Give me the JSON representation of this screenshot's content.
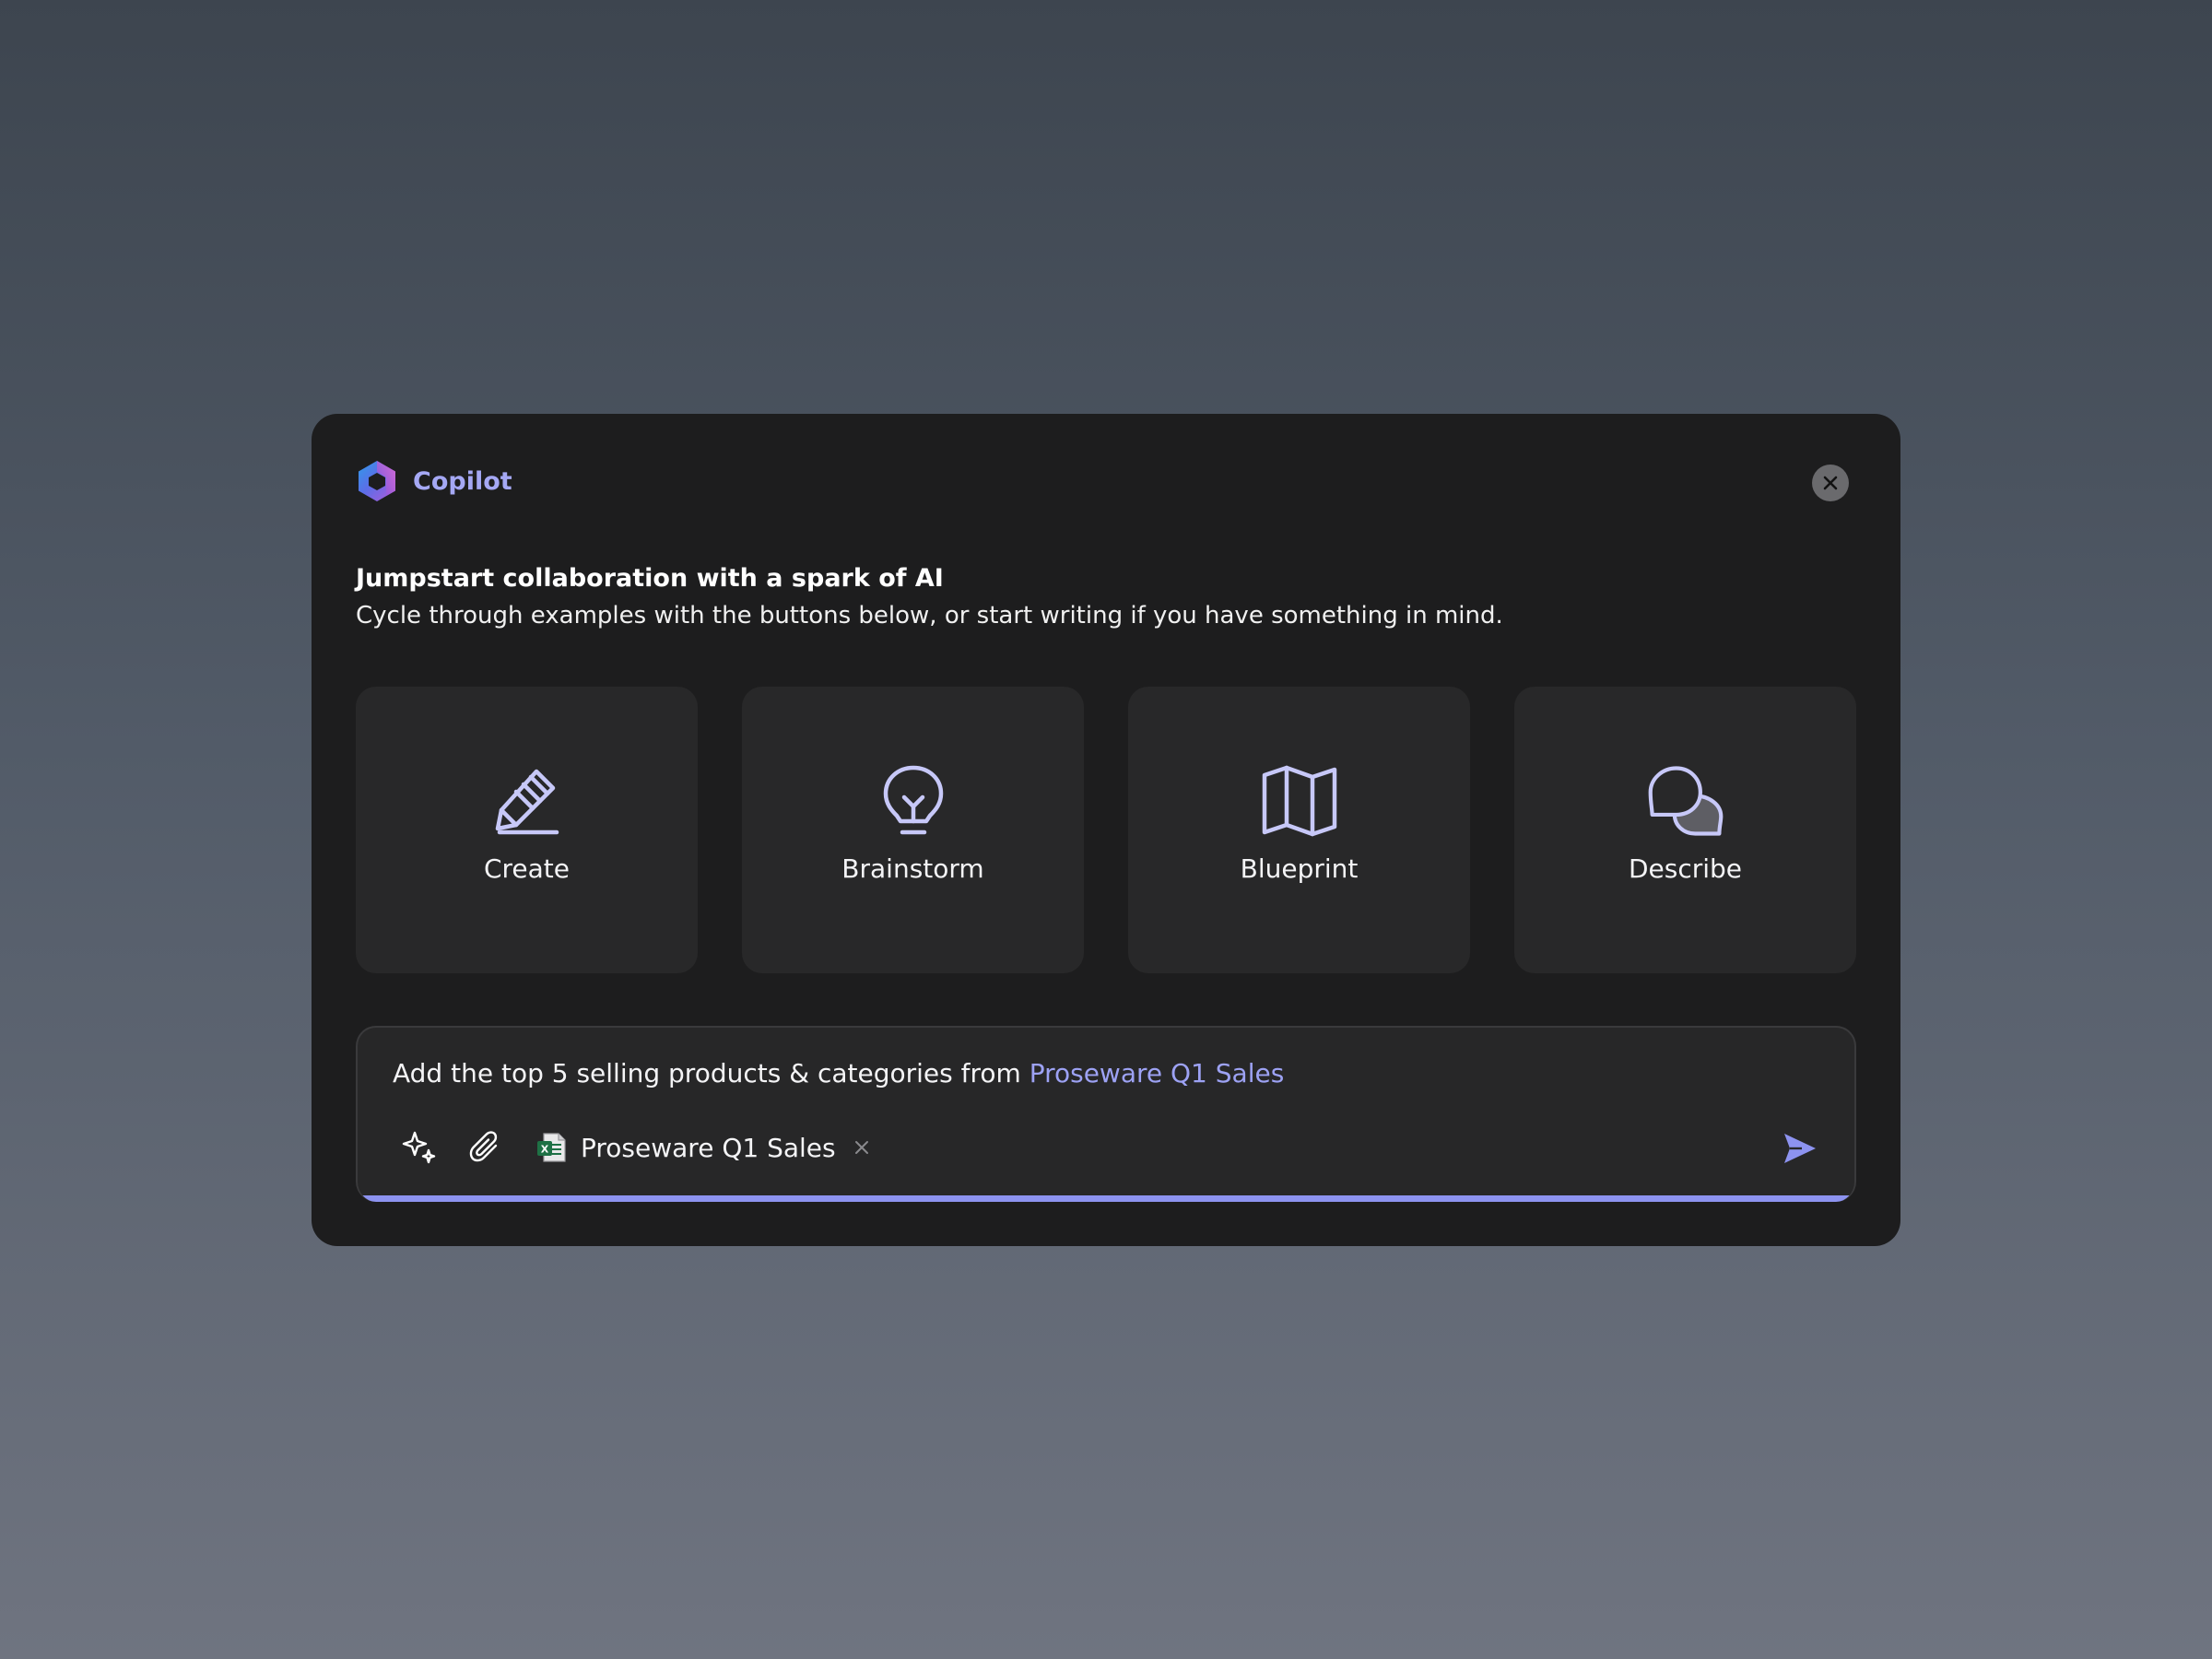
{
  "header": {
    "app_title": "Copilot",
    "close_icon": "close-icon"
  },
  "intro": {
    "title": "Jumpstart collaboration with a spark of AI",
    "subtitle": "Cycle through examples with the buttons below, or start writing if you have something in mind."
  },
  "cards": [
    {
      "label": "Create",
      "icon": "pencil-icon"
    },
    {
      "label": "Brainstorm",
      "icon": "lightbulb-icon"
    },
    {
      "label": "Blueprint",
      "icon": "map-icon"
    },
    {
      "label": "Describe",
      "icon": "chat-bubbles-icon"
    }
  ],
  "prompt": {
    "text": "Add the top 5 selling products & categories from ",
    "link_text": "Proseware Q1 Sales",
    "tools": [
      "sparkle-icon",
      "paperclip-icon"
    ],
    "attachment": {
      "label": "Proseware Q1 Sales",
      "icon": "excel-file-icon",
      "icon_letter": "X"
    },
    "send_icon": "send-icon"
  },
  "colors": {
    "accent": "#9da2f4",
    "icon_stroke": "#c7c8f8",
    "dialog_bg": "#1d1d1e",
    "card_bg": "#282829",
    "excel_green": "#1e7145"
  }
}
